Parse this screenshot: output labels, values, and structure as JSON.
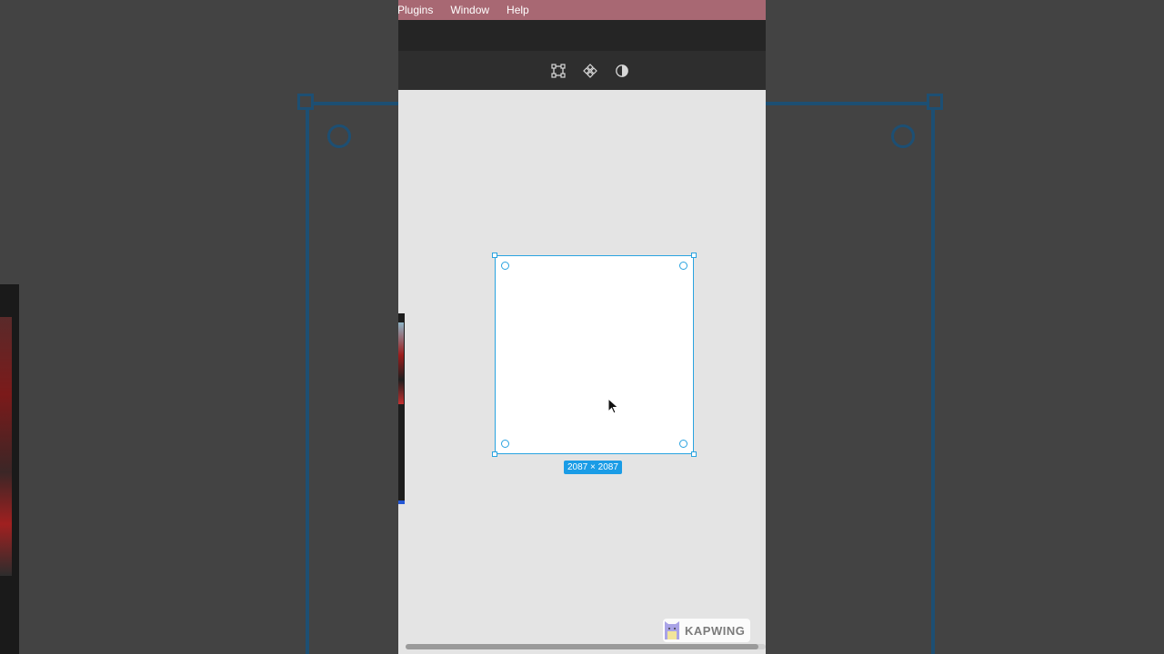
{
  "menubar": {
    "items": [
      "Plugins",
      "Window",
      "Help"
    ]
  },
  "toolbar": {
    "icons": [
      "transform-icon",
      "component-icon",
      "contrast-icon"
    ]
  },
  "artboard": {
    "size_label": "2087 × 2087"
  },
  "watermark": {
    "text": "KAPWING"
  },
  "colors": {
    "selection": "#29a3e0",
    "badge": "#1a9ce6",
    "menubar": "#a86873",
    "toolbar": "#2e2e2e",
    "canvas": "#e4e4e4"
  }
}
